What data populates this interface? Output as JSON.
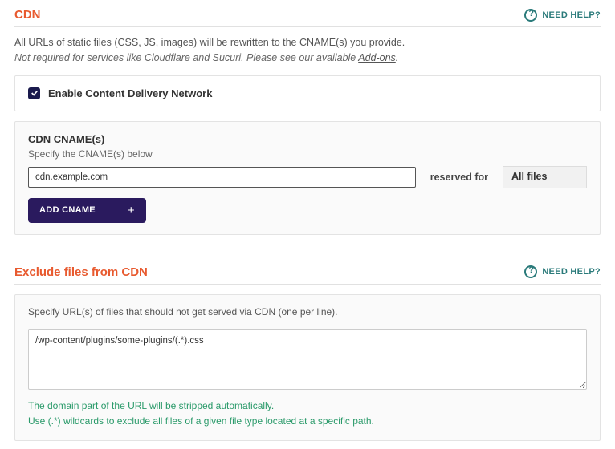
{
  "cdn": {
    "title": "CDN",
    "help_label": "NEED HELP?",
    "desc_line1": "All URLs of static files (CSS, JS, images) will be rewritten to the CNAME(s) you provide.",
    "desc_line2_prefix": "Not required for services like Cloudflare and Sucuri. Please see our available ",
    "addons_link": "Add-ons",
    "desc_line2_suffix": ".",
    "enable_label": "Enable Content Delivery Network",
    "cname_label": "CDN CNAME(s)",
    "cname_sub": "Specify the CNAME(s) below",
    "cname_value": "cdn.example.com",
    "reserved_label": "reserved for",
    "reserved_value": "All files",
    "add_cname_label": "ADD CNAME"
  },
  "exclude": {
    "title": "Exclude files from CDN",
    "help_label": "NEED HELP?",
    "desc": "Specify URL(s) of files that should not get served via CDN (one per line).",
    "textarea_value": "/wp-content/plugins/some-plugins/(.*).css",
    "hint_line1": "The domain part of the URL will be stripped automatically.",
    "hint_line2": "Use (.*) wildcards to exclude all files of a given file type located at a specific path."
  }
}
